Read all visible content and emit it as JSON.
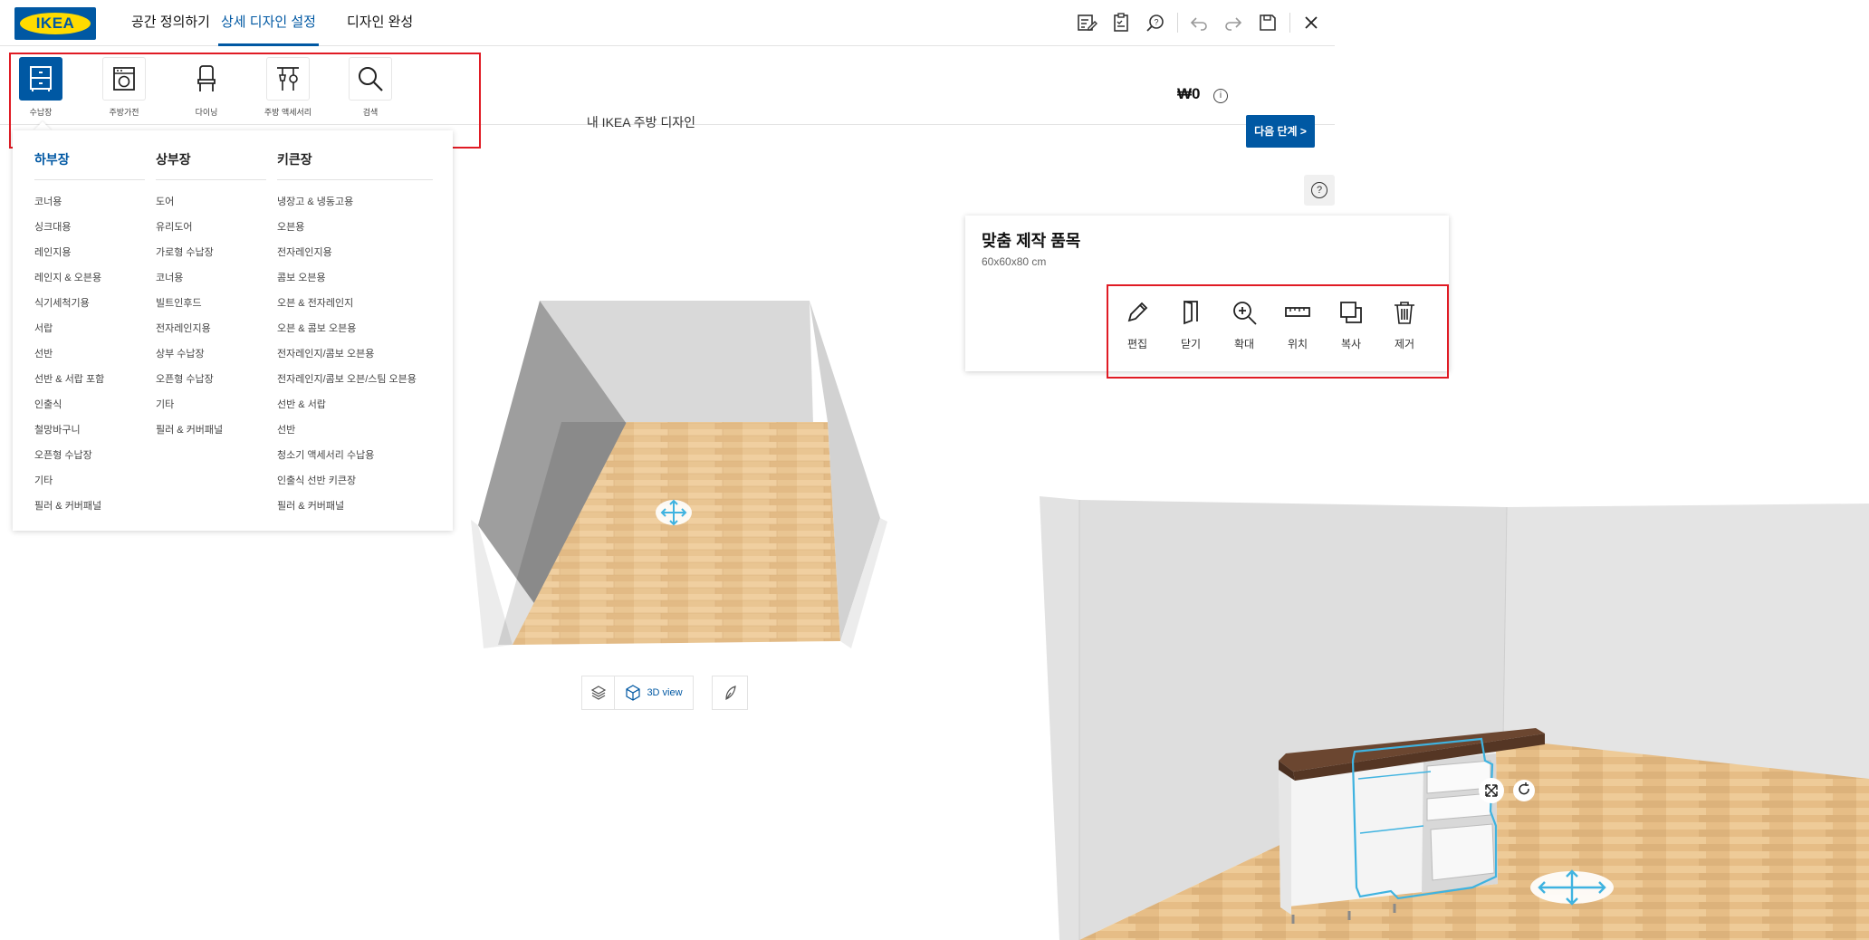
{
  "header": {
    "logo_text": "IKEA",
    "tabs": [
      {
        "label": "공간 정의하기"
      },
      {
        "label": "상세 디자인 설정"
      },
      {
        "label": "디자인 완성"
      }
    ],
    "icons": [
      "edit-notes-icon",
      "checklist-icon",
      "help-search-icon",
      "undo-icon",
      "redo-icon",
      "save-icon",
      "close-icon"
    ]
  },
  "categories": [
    {
      "label": "수납장",
      "icon": "cabinet-icon"
    },
    {
      "label": "주방가전",
      "icon": "appliance-icon"
    },
    {
      "label": "다이닝",
      "icon": "chair-icon"
    },
    {
      "label": "주방 액세서리",
      "icon": "kitchen-accessory-icon"
    },
    {
      "label": "검색",
      "icon": "search-icon"
    }
  ],
  "design": {
    "title": "내 IKEA 주방 디자인",
    "price": "₩0",
    "info": "i",
    "next_button": "다음 단계 >"
  },
  "dropdown": {
    "columns": [
      {
        "heading": "하부장",
        "items": [
          "코너용",
          "싱크대용",
          "레인지용",
          "레인지 & 오븐용",
          "식기세척기용",
          "서랍",
          "선반",
          "선반 & 서랍 포함",
          "인출식",
          "철망바구니",
          "오픈형 수납장",
          "기타",
          "필러 & 커버패널"
        ]
      },
      {
        "heading": "상부장",
        "items": [
          "도어",
          "유리도어",
          "가로형 수납장",
          "코너용",
          "빌트인후드",
          "전자레인지용",
          "상부 수납장",
          "오픈형 수납장",
          "기타",
          "필러 & 커버패널"
        ]
      },
      {
        "heading": "키큰장",
        "items": [
          "냉장고 & 냉동고용",
          "오븐용",
          "전자레인지용",
          "콤보 오븐용",
          "오븐 & 전자레인지",
          "오븐 & 콤보 오븐용",
          "전자레인지/콤보 오븐용",
          "전자레인지/콤보 오븐/스팀 오븐용",
          "선반 & 서랍",
          "선반",
          "청소기 액세서리 수납용",
          "인출식 선반 키큰장",
          "필러 & 커버패널"
        ]
      }
    ]
  },
  "help_label": "?",
  "card": {
    "title": "맞춤 제작 품목",
    "dimensions": "60x60x80 cm",
    "actions": [
      {
        "label": "편집",
        "icon": "pencil-icon"
      },
      {
        "label": "닫기",
        "icon": "door-icon"
      },
      {
        "label": "확대",
        "icon": "zoom-in-icon"
      },
      {
        "label": "위치",
        "icon": "ruler-icon"
      },
      {
        "label": "복사",
        "icon": "copy-icon"
      },
      {
        "label": "제거",
        "icon": "trash-icon"
      }
    ]
  },
  "view": {
    "label": "3D view"
  },
  "colors": {
    "ikea_blue": "#0058a3",
    "ikea_yellow": "#ffdb00",
    "highlight_red": "#e01b24",
    "selection_cyan": "#3fb3e0",
    "countertop_brown": "#6b4630"
  }
}
